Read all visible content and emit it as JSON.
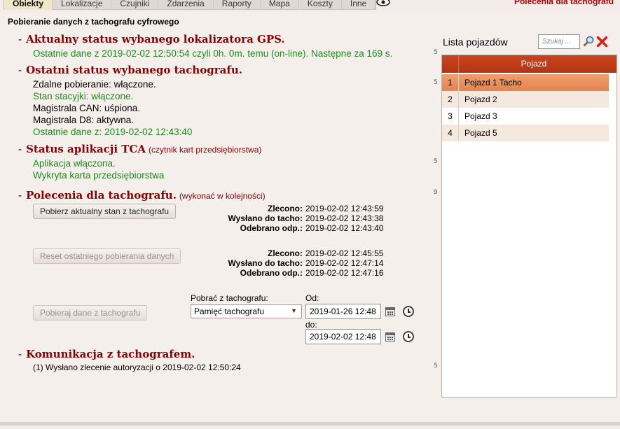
{
  "nav": {
    "tabs": [
      "Obiekty",
      "Lokalizacje",
      "Czujniki",
      "Zdarzenia",
      "Raporty",
      "Mapa",
      "Koszty",
      "Inne"
    ],
    "active_tab": "Obiekty",
    "right_link": "Polecenia dla tachografu",
    "icon": "eye-icon"
  },
  "page_title": "Pobieranie danych z tachografu cyfrowego",
  "gps": {
    "heading": "Aktualny status wybanego lokalizatora GPS.",
    "line": "Ostatnie dane z 2019-02-02 12:50:54 czyli 0h. 0m. temu (on-line). Następne za 169 s."
  },
  "tacho_status": {
    "heading": "Ostatni status wybanego tachografu.",
    "lines": [
      {
        "text": "Zdalne pobieranie: włączone.",
        "color": "#000000"
      },
      {
        "text": "Stan stacyjki: włączone.",
        "color": "#1e8a1e"
      },
      {
        "text": "Magistrala CAN: uśpiona.",
        "color": "#000000"
      },
      {
        "text": "Magistrala D8: aktywna.",
        "color": "#000000"
      },
      {
        "text": "Ostatnie dane z: 2019-02-02 12:43:40",
        "color": "#1e8a1e"
      }
    ]
  },
  "tca": {
    "heading": "Status aplikacji TCA",
    "note": "(czytnik kart przedsiębiorstwa)",
    "lines": [
      "Aplikacja włączona.",
      "Wykryta karta przedsiębiorstwa"
    ]
  },
  "commands": {
    "heading": "Polecenia dla tachografu.",
    "note": "(wykonać w kolejności)",
    "labels": {
      "ordered": "Zlecono:",
      "sent": "Wysłano do tacho:",
      "received": "Odebrano odp.:"
    },
    "items": [
      {
        "button": "Pobierz aktualny stan z tachografu",
        "ordered": "2019-02-02 12:43:59",
        "sent": "2019-02-02 12:43:38",
        "received": "2019-02-02 12:43:40"
      },
      {
        "button": "Reset ostatniego pobierania danych",
        "ordered": "2019-02-02 12:45:55",
        "sent": "2019-02-02 12:47:14",
        "received": "2019-02-02 12:47:16"
      }
    ],
    "download": {
      "button": "Pobieraj dane z tachografu",
      "source_label": "Pobrać z tachografu:",
      "source_value": "Pamięć tachografu",
      "from_label": "Od:",
      "from_value": "2019-01-26 12:48",
      "to_label": "do:",
      "to_value": "2019-02-02 12:48"
    }
  },
  "comm": {
    "heading": "Komunikacja z tachografem.",
    "line": "(1) Wysłano zlecenie autoryzacji o 2019-02-02 12:50:24"
  },
  "side_numbers": [
    "5",
    "5",
    "5",
    "9",
    "5"
  ],
  "vehicles": {
    "title": "Lista pojazdów",
    "search_placeholder": "Szukaj ...",
    "column": "Pojazd",
    "rows": [
      {
        "n": "1",
        "name": "Pojazd 1 Tacho"
      },
      {
        "n": "2",
        "name": "Pojazd 2"
      },
      {
        "n": "3",
        "name": "Pojazd 3"
      },
      {
        "n": "4",
        "name": "Pojazd 5"
      }
    ]
  }
}
